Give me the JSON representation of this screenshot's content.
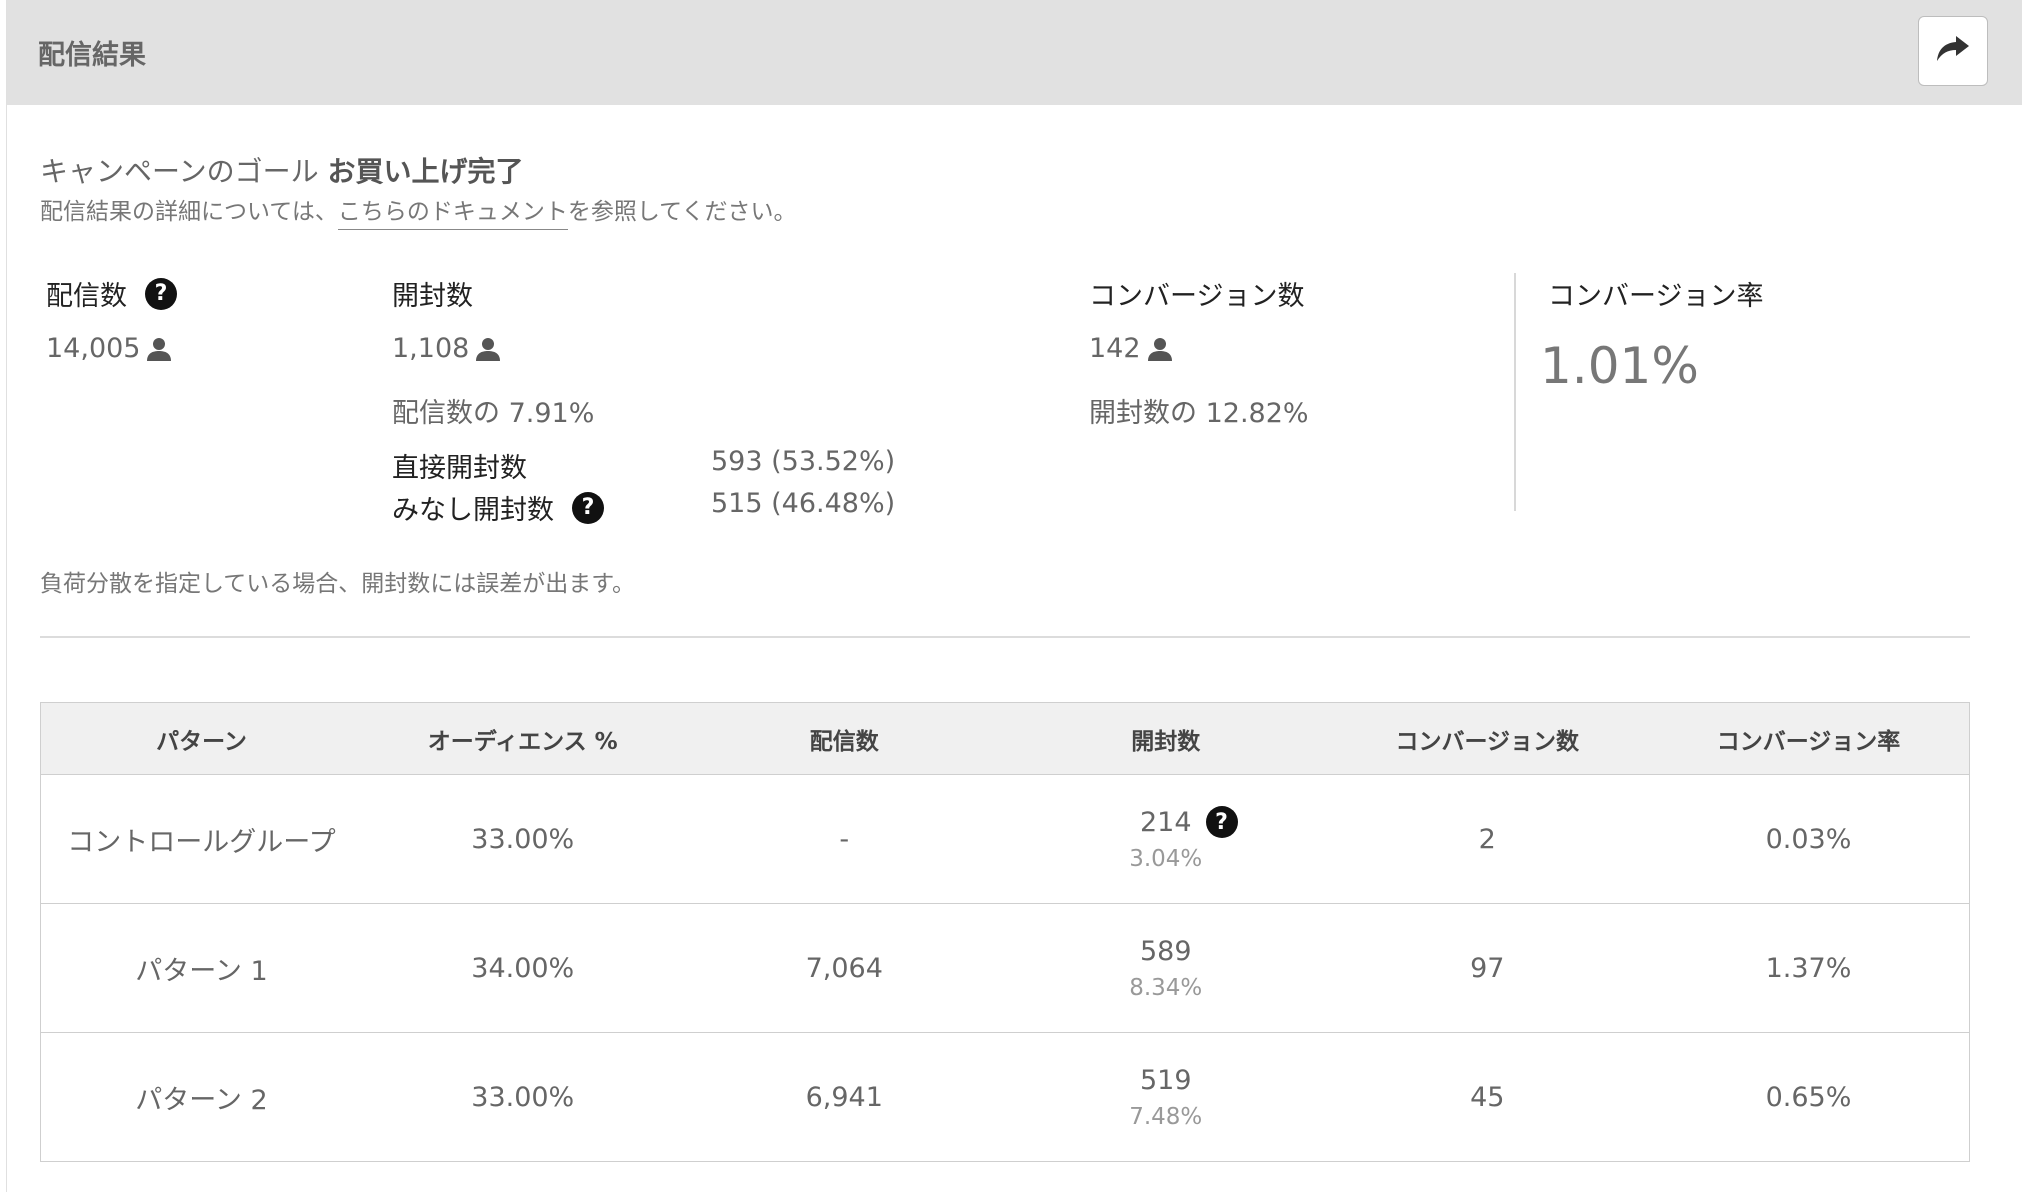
{
  "header": {
    "title": "配信結果",
    "share_icon": "share-arrow-icon"
  },
  "goal": {
    "prefix": "キャンペーンのゴール",
    "value": "お買い上げ完了"
  },
  "doc": {
    "before": "配信結果の詳細については、",
    "link": "こちらのドキュメント",
    "after": "を参照してください。"
  },
  "stats": {
    "delivered": {
      "label": "配信数",
      "value": "14,005"
    },
    "opened": {
      "label": "開封数",
      "value": "1,108",
      "ratio": "配信数の 7.91%",
      "direct_label": "直接開封数",
      "direct_value": "593 (53.52%)",
      "deemed_label": "みなし開封数",
      "deemed_value": "515 (46.48%)"
    },
    "conversions": {
      "label": "コンバージョン数",
      "value": "142",
      "ratio": "開封数の 12.82%"
    },
    "conversion_rate": {
      "label": "コンバージョン率",
      "value": "1.01%"
    }
  },
  "note": "負荷分散を指定している場合、開封数には誤差が出ます。",
  "table": {
    "headers": [
      "パターン",
      "オーディエンス %",
      "配信数",
      "開封数",
      "コンバージョン数",
      "コンバージョン率"
    ],
    "rows": [
      {
        "pattern": "コントロールグループ",
        "audience": "33.00%",
        "delivered": "-",
        "opened": "214",
        "opened_pct": "3.04%",
        "conversions": "2",
        "rate": "0.03%"
      },
      {
        "pattern": "パターン 1",
        "audience": "34.00%",
        "delivered": "7,064",
        "opened": "589",
        "opened_pct": "8.34%",
        "conversions": "97",
        "rate": "1.37%"
      },
      {
        "pattern": "パターン 2",
        "audience": "33.00%",
        "delivered": "6,941",
        "opened": "519",
        "opened_pct": "7.48%",
        "conversions": "45",
        "rate": "0.65%"
      }
    ]
  },
  "colors": {
    "header_bg": "#e1e1e1",
    "table_header_bg": "#f0f0f0",
    "help_icon": "#111111"
  }
}
